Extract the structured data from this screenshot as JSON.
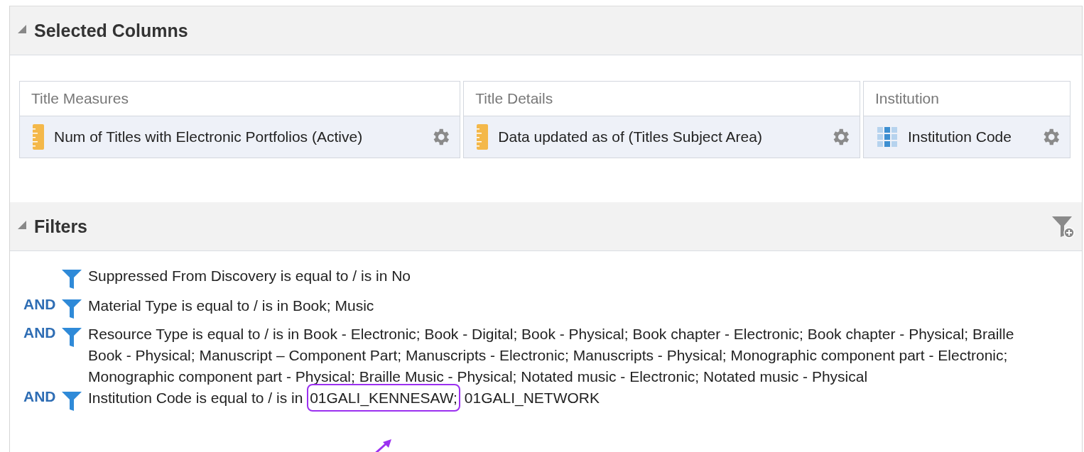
{
  "selected_columns": {
    "title": "Selected Columns",
    "expanded": true,
    "groups": [
      {
        "heading": "Title Measures",
        "column": {
          "kind": "measure",
          "label": "Num of Titles with Electronic Portfolios (Active)"
        }
      },
      {
        "heading": "Title Details",
        "column": {
          "kind": "measure",
          "label": "Data updated as of (Titles Subject Area)"
        }
      },
      {
        "heading": "Institution",
        "column": {
          "kind": "attribute",
          "label": "Institution Code"
        }
      }
    ]
  },
  "filters": {
    "title": "Filters",
    "expanded": true,
    "items": [
      {
        "condition": "Suppressed From Discovery is equal to / is in ",
        "values": [
          {
            "text": "No",
            "highlighted": false
          }
        ]
      },
      {
        "operator": "AND",
        "condition": "Material Type is equal to / is in ",
        "values": [
          {
            "text": "Book; Music",
            "highlighted": false
          }
        ]
      },
      {
        "operator": "AND",
        "condition": "Resource Type is equal to / is in ",
        "values": [
          {
            "text": "Book - Electronic; Book - Digital; Book - Physical; Book chapter - Electronic; Book chapter - Physical; Braille Book - Physical; Manuscript – Component Part; Manuscripts - Electronic; Manuscripts - Physical; Monographic component part - Electronic; Monographic component part - Physical; Braille Music - Physical; Notated music - Electronic; Notated music - Physical",
            "highlighted": false
          }
        ]
      },
      {
        "operator": "AND",
        "condition": "Institution Code is equal to / is in ",
        "values": [
          {
            "text": "01GALI_KENNESAW;",
            "highlighted": true
          },
          {
            "text": "01GALI_NETWORK",
            "highlighted": false
          }
        ]
      }
    ]
  }
}
